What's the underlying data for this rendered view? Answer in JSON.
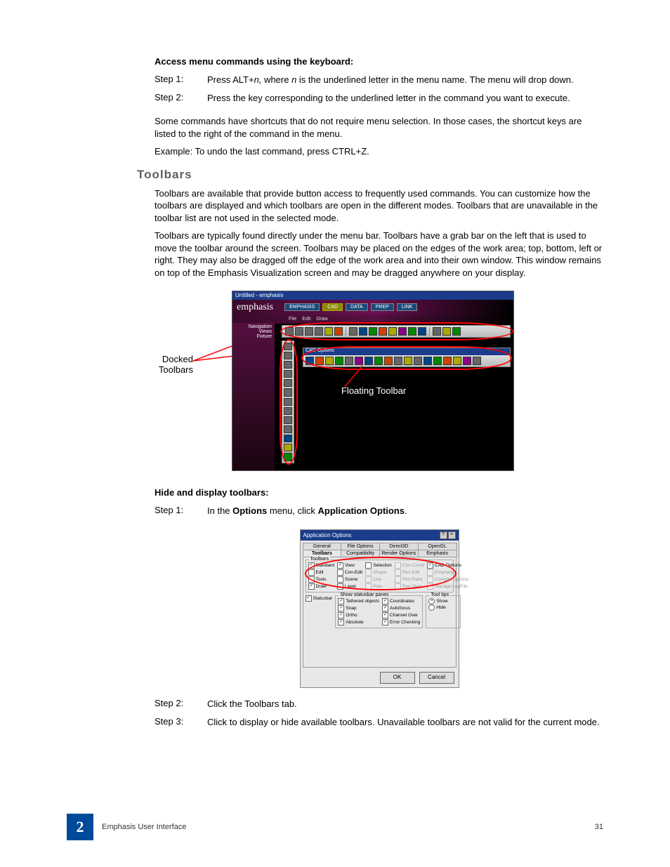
{
  "section1_title": "Access menu commands using the keyboard:",
  "step1_1_label": "Step 1:",
  "step1_1_text_a": "Press ALT+",
  "step1_1_n": "n,",
  "step1_1_text_b": " where ",
  "step1_1_n2": "n",
  "step1_1_text_c": " is the underlined letter in the menu name. The menu will drop down.",
  "step1_2_label": "Step 2:",
  "step1_2_text": "Press the key corresponding to the underlined letter in the command you want to execute.",
  "para1": "Some commands have shortcuts that do not require menu selection. In those cases, the shortcut keys are listed to the right of the command in the menu.",
  "para2": "Example: To undo the last command, press CTRL+Z.",
  "heading_toolbars": "Toolbars",
  "para3": "Toolbars are available that provide button access to frequently used commands. You can customize how the toolbars are displayed and which toolbars are open in the different modes. Toolbars that are unavailable in the toolbar list are not used in the selected mode.",
  "para4": "Toolbars are typically found directly under the menu bar. Toolbars have a grab bar on the left that is used to move the toolbar around the screen. Toolbars may be placed on the edges of the work area; top, bottom, left or right. They may also be dragged off the edge of the work area and into their own window. This window remains on top of the Emphasis Visualization screen and may be dragged anywhere on your display.",
  "fig1": {
    "docked_label": "Docked Toolbars",
    "floating_label": "Floating Toolbar",
    "window_title": "Untitled - emphasis",
    "logo": "emphasis",
    "tabs": [
      "EMPHASIS",
      "CAD",
      "DATA",
      "PREP",
      "LINK"
    ],
    "menus": [
      "File",
      "Edit",
      "Draw"
    ],
    "leftpanel": [
      "Navigation",
      "Views",
      "Fixture"
    ],
    "floating_title": "CAD Options"
  },
  "section2_title": "Hide and display toolbars:",
  "step2_1_label": "Step 1:",
  "step2_1_a": "In the ",
  "step2_1_b": "Options",
  "step2_1_c": " menu, click ",
  "step2_1_d": "Application Options",
  "step2_1_e": ".",
  "fig2": {
    "title": "Application Options",
    "tabs_row1": [
      "General",
      "File Options",
      "Direct3D",
      "OpenGL"
    ],
    "tabs_row2": [
      "Toolbars",
      "Compatibility",
      "Render Options",
      "Emphasis"
    ],
    "active_tab": "Toolbars",
    "group_toolbars": "Toolbars",
    "toolbars": [
      {
        "label": "Standard",
        "checked": true,
        "disabled": false
      },
      {
        "label": "View",
        "checked": true,
        "disabled": false
      },
      {
        "label": "Selection",
        "checked": false,
        "disabled": false
      },
      {
        "label": "Con-Const",
        "checked": false,
        "disabled": true
      },
      {
        "label": "CAD Options",
        "checked": true,
        "disabled": false
      },
      {
        "label": "Edit",
        "checked": false,
        "disabled": false
      },
      {
        "label": "Con-Edit",
        "checked": false,
        "disabled": false
      },
      {
        "label": "Shape",
        "checked": false,
        "disabled": true
      },
      {
        "label": "Pen Edit",
        "checked": false,
        "disabled": true
      },
      {
        "label": "Emphasis",
        "checked": false,
        "disabled": true
      },
      {
        "label": "Tools",
        "checked": false,
        "disabled": false
      },
      {
        "label": "Scene",
        "checked": false,
        "disabled": false
      },
      {
        "label": "Live",
        "checked": false,
        "disabled": true
      },
      {
        "label": "Pen-Paint",
        "checked": false,
        "disabled": true
      },
      {
        "label": "Compile Options",
        "checked": false,
        "disabled": true
      },
      {
        "label": "Draw",
        "checked": true,
        "disabled": false
      },
      {
        "label": "Layer",
        "checked": false,
        "disabled": false
      },
      {
        "label": "Plan",
        "checked": false,
        "disabled": true
      },
      {
        "label": "Pen-View",
        "checked": false,
        "disabled": true
      },
      {
        "label": "Manage LogFile",
        "checked": false,
        "disabled": true
      }
    ],
    "statusbar_check": {
      "label": "Statusbar",
      "checked": true
    },
    "group_panes": "Show statusbar panes",
    "panes": [
      {
        "label": "Tethered objects",
        "checked": true
      },
      {
        "label": "Coordinates",
        "checked": true
      },
      {
        "label": "Snap",
        "checked": true
      },
      {
        "label": "Autofocus",
        "checked": true
      },
      {
        "label": "Ortho",
        "checked": true
      },
      {
        "label": "Channel Over",
        "checked": true
      },
      {
        "label": "Absolute",
        "checked": true
      },
      {
        "label": "Error Checking",
        "checked": true
      }
    ],
    "group_tooltips": "Tool tips",
    "tooltips": [
      {
        "label": "Show",
        "checked": true,
        "type": "radio"
      },
      {
        "label": "Hide",
        "checked": false,
        "type": "radio"
      }
    ],
    "buttons": [
      "OK",
      "Cancel"
    ]
  },
  "step2_2_label": "Step 2:",
  "step2_2_text": "Click the Toolbars tab.",
  "step2_3_label": "Step 3:",
  "step2_3_text": "Click to display or hide available toolbars. Unavailable toolbars are not valid for the current mode.",
  "footer": {
    "chapter": "2",
    "title": "Emphasis User Interface",
    "page": "31"
  }
}
